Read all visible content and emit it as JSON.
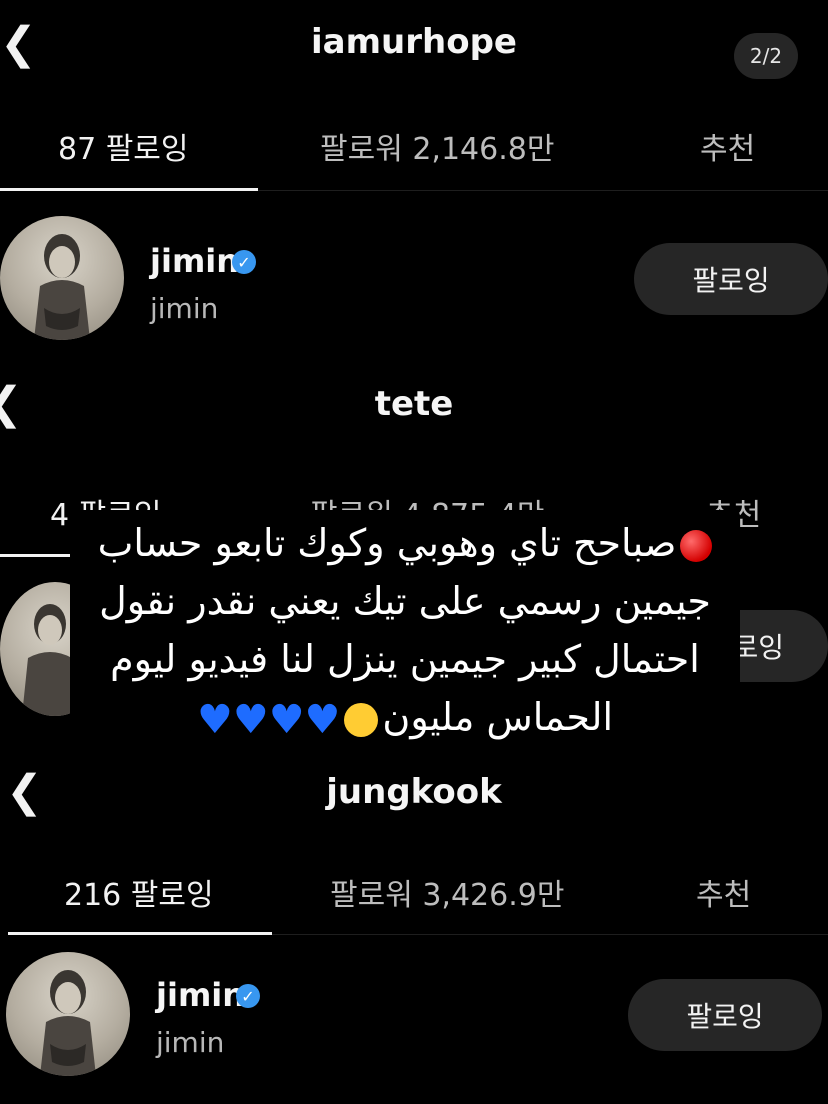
{
  "screens": [
    {
      "title": "iamurhope",
      "page_indicator": "2/2",
      "tabs": [
        "87 팔로잉",
        "팔로워 2,146.8만",
        "추천"
      ],
      "row": {
        "name": "jimin",
        "handle": "jimin",
        "button": "팔로잉"
      }
    },
    {
      "title": "tete",
      "tabs": [
        "4 팔로잉",
        "팔로워 4,875.4만",
        "추천"
      ],
      "row": {
        "button": "팔로잉"
      }
    },
    {
      "title": "jungkook",
      "tabs": [
        "216 팔로잉",
        "팔로워 3,426.9만",
        "추천"
      ],
      "row": {
        "name": "jimin",
        "handle": "jimin",
        "button": "팔로잉"
      }
    }
  ],
  "overlay_text": {
    "line1": "صباحح تاي وهوبي وكوك تابعو حساب",
    "line2": "جيمين رسمي على تيك يعني نقدر نقول",
    "line3": "احتمال كبير جيمين ينزل لنا فيديو ليوم",
    "line4": "الحماس مليون"
  },
  "icons": {
    "back": "chevron-left-icon",
    "verified": "verified-badge-icon",
    "red_circle": "red-circle-emoji",
    "crying_face": "crying-face-emoji",
    "blue_heart": "blue-heart-emoji"
  },
  "colors": {
    "background": "#000000",
    "button": "#262626",
    "verified": "#3897f0",
    "heart": "#1e6cff"
  }
}
